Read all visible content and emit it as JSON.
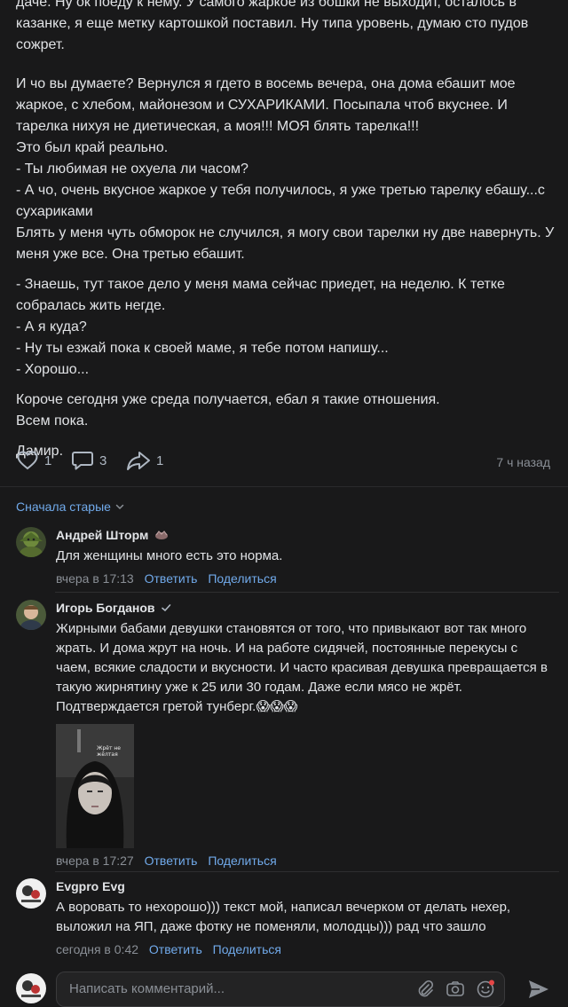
{
  "post": {
    "paragraphs": [
      "даче. Ну ок поеду к нему. У самого жаркое из бошки не выходит, осталось в казанке, я еще метку картошкой поставил. Ну типа уровень, думаю сто пудов сожрет.",
      "И чо вы думаете? Вернулся я гдето в восемь вечера, она дома ебашит мое жаркое, с хлебом, майонезом и СУХАРИКАМИ. Посыпала чтоб вкуснее. И тарелка нихуя не диетическая, а моя!!! МОЯ блять тарелка!!!\nЭто был край реально.\n- Ты любимая не охуела ли часом?\n- А чо, очень вкусное жаркое у тебя получилось, я уже третью тарелку ебашу...с сухариками\nБлять у меня чуть обморок не случился, я могу свои тарелки ну две навернуть. У меня уже все. Она третью ебашит.",
      "- Знаешь, тут такое дело у меня мама сейчас приедет, на неделю. К тетке собралась жить негде.\n- А я куда?\n- Ну ты езжай пока к своей маме, я тебе потом напишу...\n- Хорошо...",
      "Короче сегодня уже среда получается, ебал я такие отношения.\nВсем пока.",
      "Дамир."
    ],
    "likes": "1",
    "comments": "3",
    "shares": "1",
    "time_ago": "7 ч назад"
  },
  "sort_label": "Сначала старые",
  "comments": [
    {
      "author": "Андрей Шторм",
      "text": "Для женщины много есть это норма.",
      "time": "вчера в 17:13",
      "reply": "Ответить",
      "share": "Поделиться"
    },
    {
      "author": "Игорь Богданов",
      "text": "Жирными бабами девушки становятся от того, что привыкают вот так много жрать. И дома жрут на ночь. И на работе сидячей, постоянные перекусы с чаем, всякие сладости и вкусности. И часто красивая девушка превращается в такую жирнятину уже к 25 или 30 годам. Даже если мясо не жрёт. Подтверждается гретой тунберг.",
      "emoji": "😱😱😱",
      "photo_caption": "Жрёт не жёлтая",
      "time": "вчера в 17:27",
      "reply": "Ответить",
      "share": "Поделиться"
    },
    {
      "author": "Evgpro Evg",
      "text": "А воровать то нехорошо))) текст мой, написал вечерком от делать нехер, выложил на ЯП, даже фотку не поменяли, молодцы))) рад что зашло",
      "time": "сегодня в 0:42",
      "reply": "Ответить",
      "share": "Поделиться"
    }
  ],
  "composer": {
    "placeholder": "Написать комментарий..."
  },
  "colors": {
    "background": "#19191a",
    "link": "#71aaeb",
    "secondary": "#8a8f96",
    "text": "#e1e3e6"
  }
}
